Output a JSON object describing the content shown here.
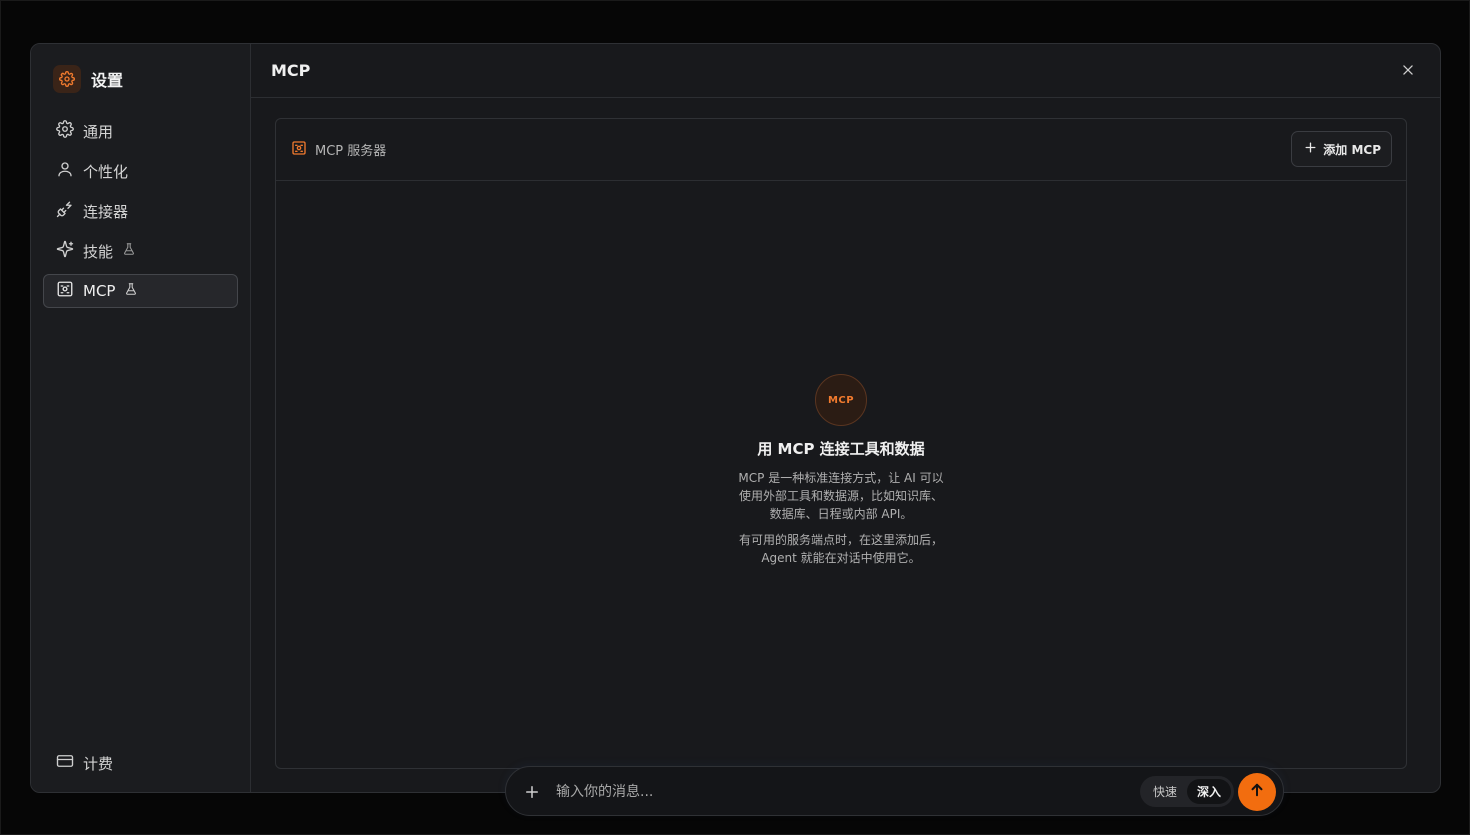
{
  "sidebar": {
    "title": "设置",
    "items": [
      {
        "label": "通用",
        "icon": "gear-icon"
      },
      {
        "label": "个性化",
        "icon": "user-icon"
      },
      {
        "label": "连接器",
        "icon": "plug-icon"
      },
      {
        "label": "技能",
        "icon": "sparkles-icon",
        "badge_icon": "flask-icon"
      },
      {
        "label": "MCP",
        "icon": "server-icon",
        "badge_icon": "flask-icon",
        "active": true
      }
    ],
    "bottom_item": {
      "label": "计费",
      "icon": "credit-card-icon"
    }
  },
  "main": {
    "title": "MCP",
    "panel": {
      "label": "MCP 服务器",
      "add_button": "添加 MCP",
      "empty": {
        "badge": "MCP",
        "title": "用 MCP 连接工具和数据",
        "description": "MCP 是一种标准连接方式，让 AI 可以使用外部工具和数据源，比如知识库、数据库、日程或内部 API。",
        "description2": "有可用的服务端点时，在这里添加后，Agent 就能在对话中使用它。"
      }
    }
  },
  "chat": {
    "placeholder": "输入你的消息...",
    "modes": [
      "快速",
      "深入"
    ],
    "active_mode": "深入"
  },
  "colors": {
    "accent": "#f26d0f",
    "background": "#18191c"
  }
}
